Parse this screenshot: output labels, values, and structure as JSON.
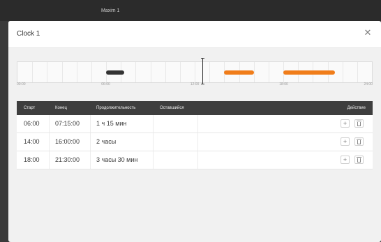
{
  "backdrop": {
    "title": "Maxim 1"
  },
  "dialog": {
    "title": "Clock 1",
    "close_label": "✕"
  },
  "timeline": {
    "ticks": [
      "00:00",
      "06:00",
      "12:00",
      "18:00",
      "24:00"
    ],
    "segments": [
      {
        "start": "06:00",
        "end": "07:15",
        "color": "#333333"
      },
      {
        "start": "14:00",
        "end": "16:00",
        "color": "#f07d1a"
      },
      {
        "start": "18:00",
        "end": "21:30",
        "color": "#f07d1a"
      }
    ],
    "cursor_time": "12:30"
  },
  "table": {
    "headers": {
      "start": "Старт",
      "end": "Конец",
      "duration": "Продолжительность",
      "remaining": "Оставшийся",
      "actions": "Действие"
    },
    "rows": [
      {
        "start": "06:00",
        "end": "07:15:00",
        "duration": "1 ч 15 мин",
        "remaining": ""
      },
      {
        "start": "14:00",
        "end": "16:00:00",
        "duration": "2 часы",
        "remaining": ""
      },
      {
        "start": "18:00",
        "end": "21:30:00",
        "duration": "3 часы 30 мин",
        "remaining": ""
      }
    ],
    "add_label": "+"
  }
}
